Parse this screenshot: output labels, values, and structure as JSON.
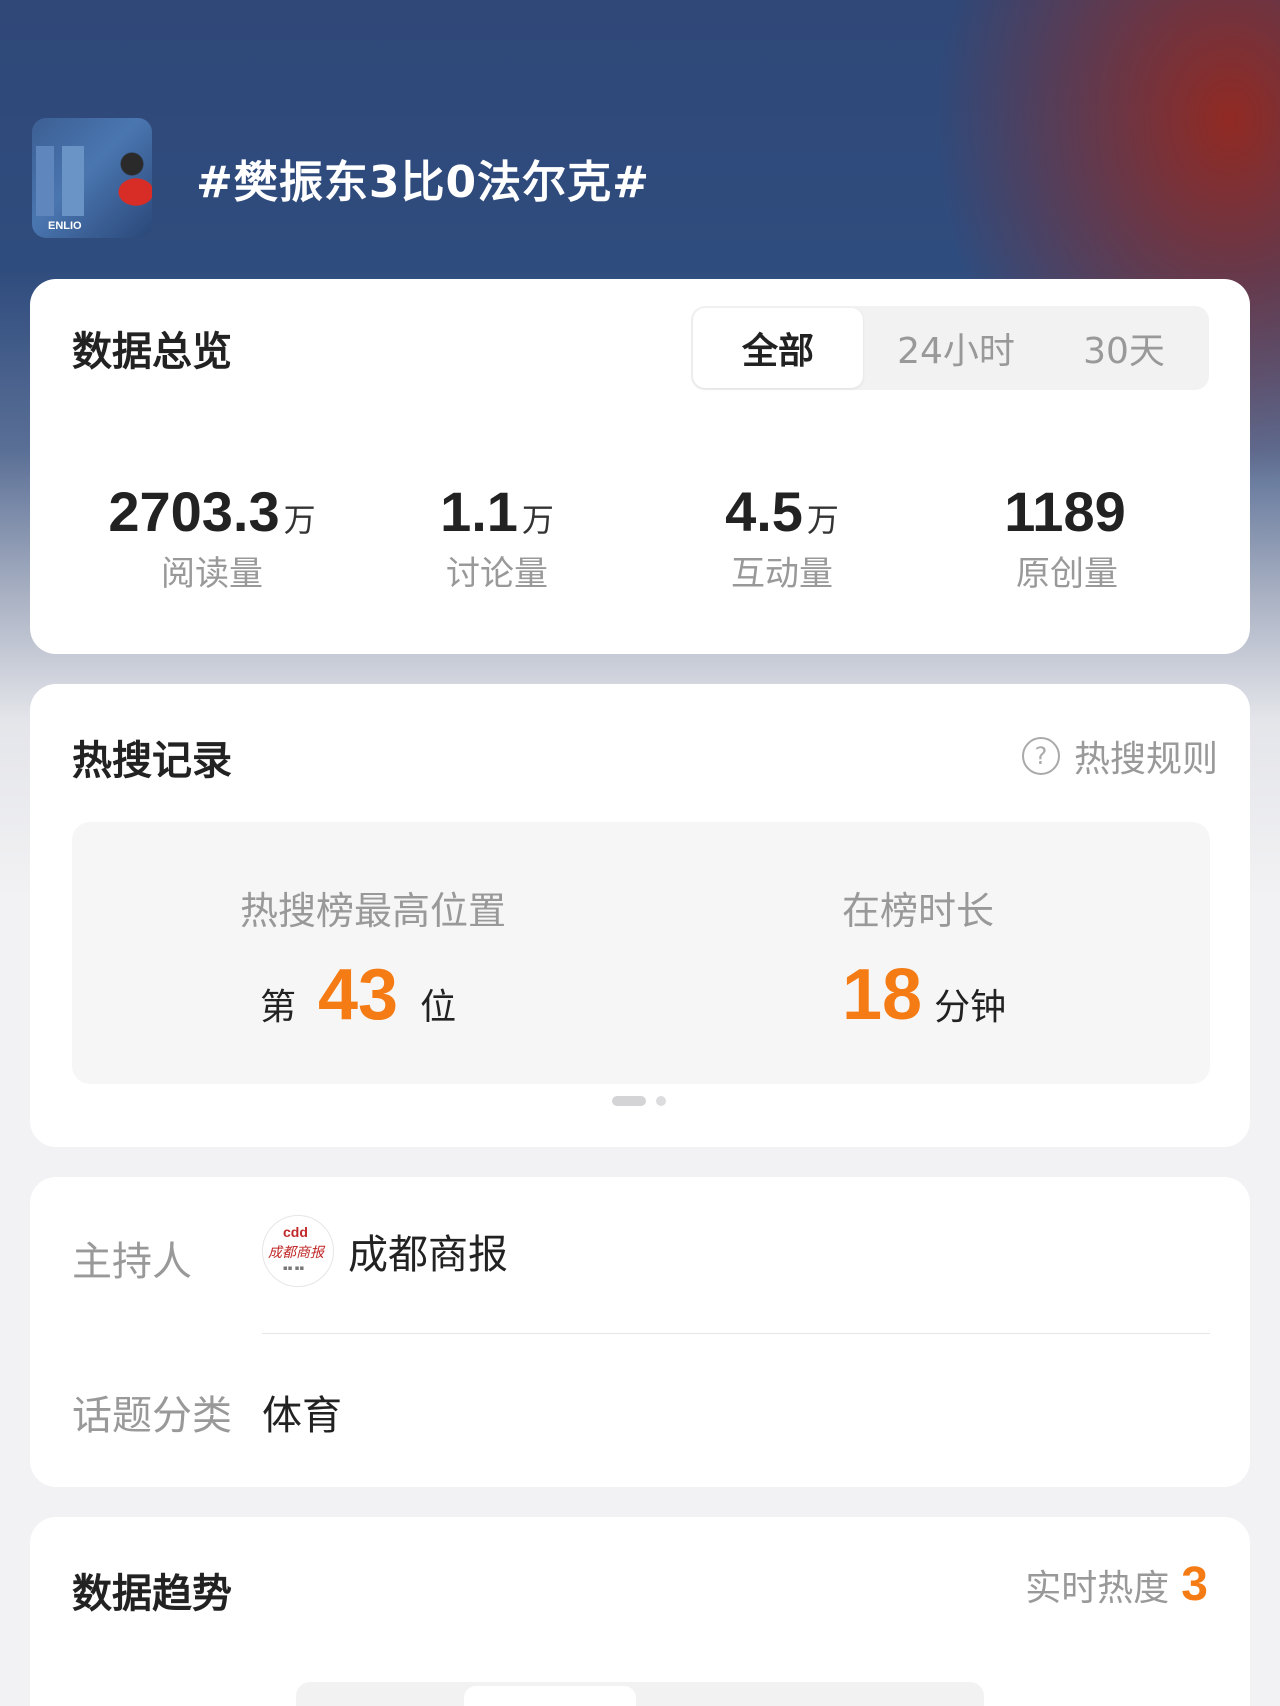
{
  "topic": {
    "title": "#樊振东3比0法尔克#",
    "thumbnail_logo": "ENLIO"
  },
  "overview": {
    "title": "数据总览",
    "tabs": [
      "全部",
      "24小时",
      "30天"
    ],
    "active_tab": "全部",
    "stats": [
      {
        "value": "2703.3",
        "unit": "万",
        "label": "阅读量"
      },
      {
        "value": "1.1",
        "unit": "万",
        "label": "讨论量"
      },
      {
        "value": "4.5",
        "unit": "万",
        "label": "互动量"
      },
      {
        "value": "1189",
        "unit": "",
        "label": "原创量"
      }
    ]
  },
  "hot_search": {
    "title": "热搜记录",
    "rule_link": "热搜规则",
    "max_position_label": "热搜榜最高位置",
    "max_position_prefix": "第",
    "max_position_value": "43",
    "max_position_suffix": "位",
    "duration_label": "在榜时长",
    "duration_value": "18",
    "duration_unit": "分钟",
    "page_count": 2,
    "current_page": 1
  },
  "info": {
    "host_label": "主持人",
    "host_name": "成都商报",
    "host_logo_text": "成都商报",
    "category_label": "话题分类",
    "category_value": "体育"
  },
  "trend": {
    "title": "数据趋势",
    "realtime_label": "实时热度",
    "realtime_value": "3"
  },
  "colors": {
    "accent": "#f57c14",
    "header_blue": "#2f4878",
    "header_red": "#962820"
  }
}
